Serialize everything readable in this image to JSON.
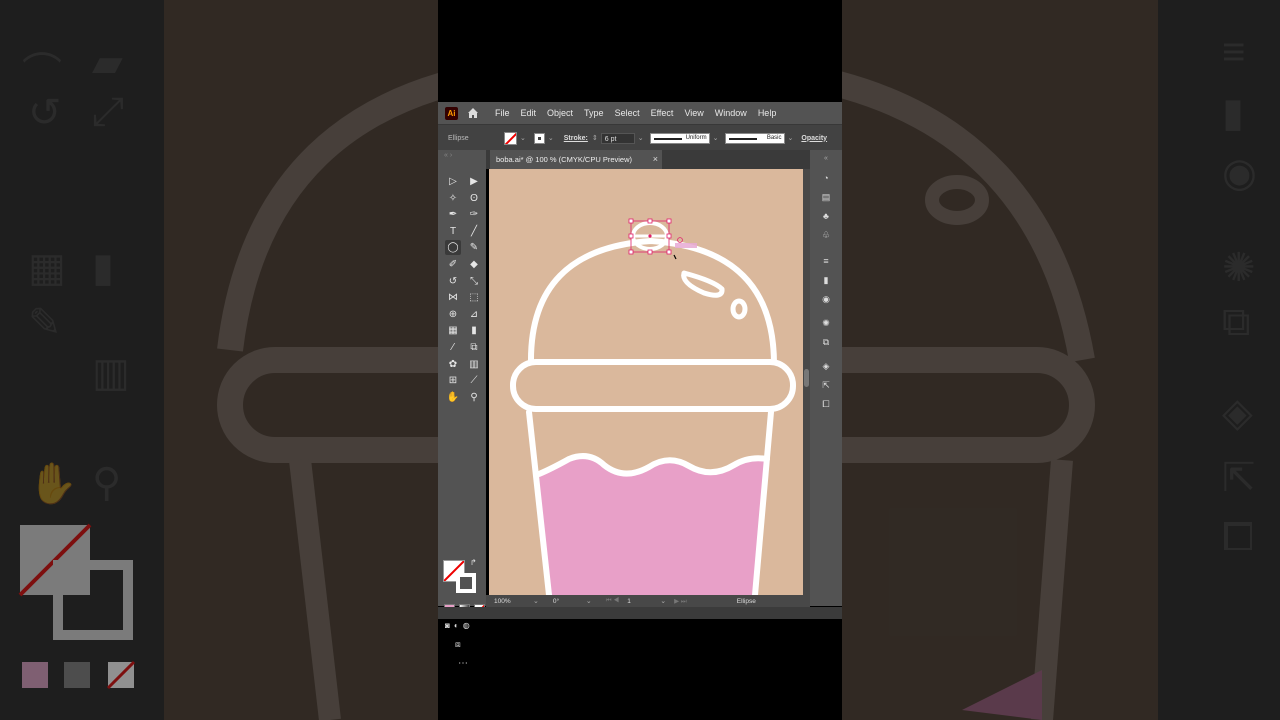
{
  "app": {
    "logo": "Ai"
  },
  "menu": [
    "File",
    "Edit",
    "Object",
    "Type",
    "Select",
    "Effect",
    "View",
    "Window",
    "Help"
  ],
  "control_bar": {
    "selection_label": "Ellipse",
    "stroke_label": "Stroke:",
    "stroke_value": "6 pt",
    "profile": "Uniform",
    "brush": "Basic",
    "opacity_label": "Opacity"
  },
  "document_tab": {
    "title": "boba.ai* @ 100 % (CMYK/CPU Preview)",
    "close": "×"
  },
  "status_bar": {
    "zoom": "100%",
    "rotation": "0°",
    "page": "1",
    "current_tool": "Ellipse"
  },
  "colors": {
    "artboard": "#dab89c",
    "drink": "#e8a0c8",
    "outline": "#ffffff",
    "panel": "#535353",
    "selection": "#e0206a"
  },
  "artwork": {
    "selection_hint": "ellipse"
  }
}
